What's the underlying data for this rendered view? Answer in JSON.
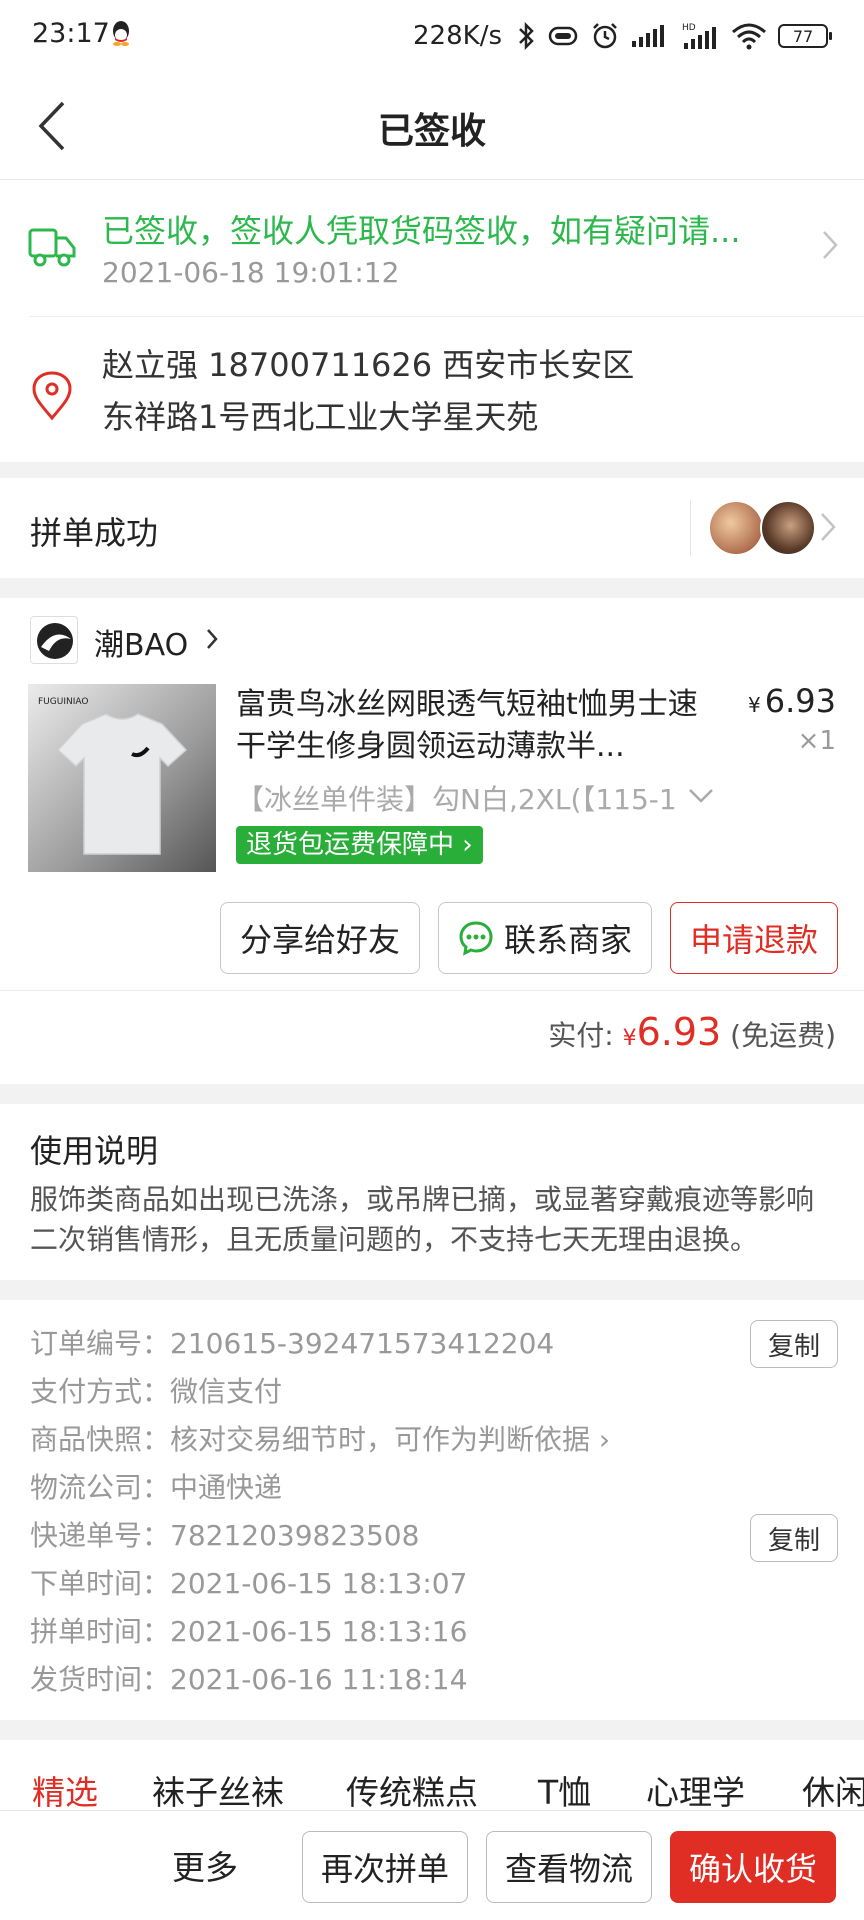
{
  "status_bar": {
    "time": "23:17",
    "speed": "228K/s",
    "battery": "77"
  },
  "header": {
    "title": "已签收"
  },
  "logistics": {
    "status": "已签收，签收人凭取货码签收，如有疑问请...",
    "time": "2021-06-18 19:01:12",
    "address_line1": "赵立强  18700711626  西安市长安区",
    "address_line2": "东祥路1号西北工业大学星天苑",
    "status_color": "#2db84d"
  },
  "group": {
    "label": "拼单成功"
  },
  "product": {
    "shop_name": "潮BAO",
    "title": "富贵鸟冰丝网眼透气短袖t恤男士速干学生修身圆领运动薄款半...",
    "price_symbol": "¥",
    "price": "6.93",
    "qty": "×1",
    "spec": "【冰丝单件装】勾N白,2XL(【115-1",
    "guarantee": "退货包运费保障中",
    "buttons": {
      "share": "分享给好友",
      "contact": "联系商家",
      "refund": "申请退款"
    },
    "paid_label": "实付:",
    "paid_symbol": "¥",
    "paid_amount": "6.93",
    "paid_note": "(免运费)",
    "accent_color": "#e02e24"
  },
  "usage": {
    "title": "使用说明",
    "text": "服饰类商品如出现已洗涤，或吊牌已摘，或显著穿戴痕迹等影响二次销售情形，且无质量问题的，不支持七天无理由退换。"
  },
  "order_info": {
    "rows": [
      {
        "label": "订单编号：",
        "value": "210615-392471573412204"
      },
      {
        "label": "支付方式：",
        "value": "微信支付"
      },
      {
        "label": "商品快照：",
        "value": "核对交易细节时，可作为判断依据"
      },
      {
        "label": "物流公司：",
        "value": "中通快递"
      },
      {
        "label": "快递单号：",
        "value": "78212039823508"
      },
      {
        "label": "下单时间：",
        "value": "2021-06-15 18:13:07"
      },
      {
        "label": "拼单时间：",
        "value": "2021-06-15 18:13:16"
      },
      {
        "label": "发货时间：",
        "value": "2021-06-16 11:18:14"
      }
    ],
    "copy_label": "复制"
  },
  "categories": [
    "精选",
    "袜子丝袜",
    "传统糕点",
    "T恤",
    "心理学",
    "休闲"
  ],
  "bottom_bar": {
    "more": "更多",
    "regroup": "再次拼单",
    "logistics": "查看物流",
    "confirm": "确认收货"
  }
}
